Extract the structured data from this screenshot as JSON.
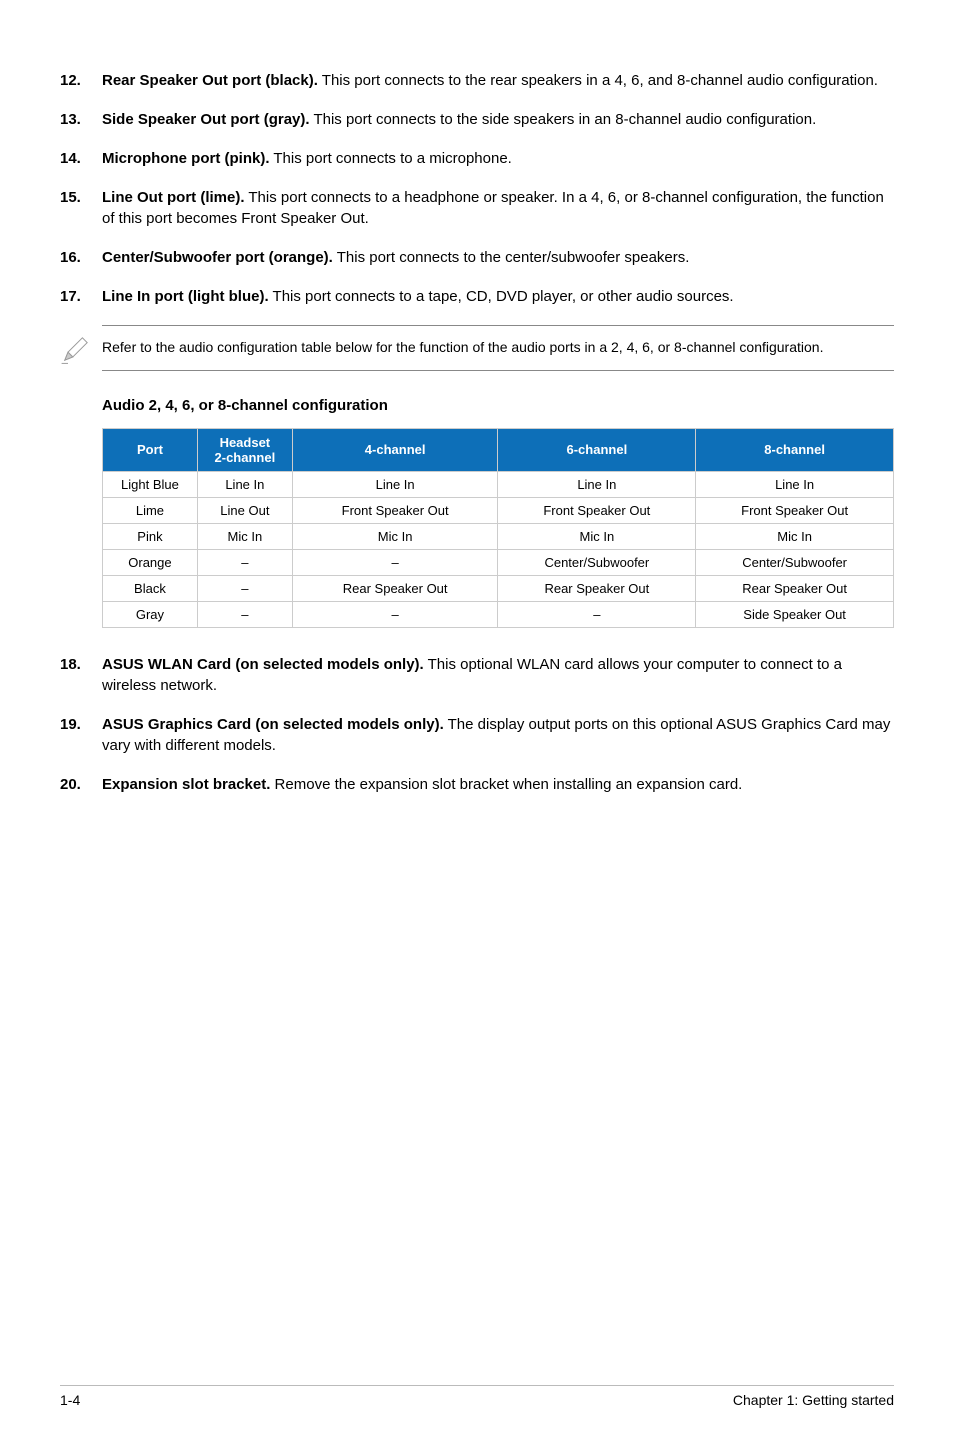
{
  "items": {
    "i12": {
      "num": "12.",
      "bold": "Rear Speaker Out port (black).",
      "text": " This port connects to the rear speakers in a 4, 6, and 8-channel audio configuration."
    },
    "i13": {
      "num": "13.",
      "bold": "Side Speaker Out port (gray).",
      "text": " This port connects to the side speakers in an 8-channel audio configuration."
    },
    "i14": {
      "num": "14.",
      "bold": "Microphone port (pink).",
      "text": " This port connects to a microphone."
    },
    "i15": {
      "num": "15.",
      "bold": "Line Out port (lime).",
      "text": " This port connects to a headphone or speaker. In a 4, 6, or 8-channel configuration, the function of this port becomes Front Speaker Out."
    },
    "i16": {
      "num": "16.",
      "bold": "Center/Subwoofer port (orange).",
      "text": " This port connects to the center/subwoofer speakers."
    },
    "i17": {
      "num": "17.",
      "bold": "Line In port (light blue).",
      "text": " This port connects to a tape, CD, DVD player, or other audio sources."
    },
    "i18": {
      "num": "18.",
      "bold": "ASUS WLAN Card (on selected models only).",
      "text": " This optional WLAN card allows your computer to connect to a wireless network."
    },
    "i19": {
      "num": "19.",
      "bold": "ASUS Graphics Card (on selected models only).",
      "text": " The display output ports on this optional ASUS Graphics Card may vary with different models."
    },
    "i20": {
      "num": "20.",
      "bold": "Expansion slot bracket.",
      "text": " Remove the expansion slot bracket when installing an expansion card."
    }
  },
  "note": "Refer to the audio configuration table below for the function of the audio ports in a 2, 4, 6, or 8-channel configuration.",
  "table": {
    "title": "Audio 2, 4, 6, or 8-channel configuration",
    "headers": {
      "port": "Port",
      "h2a": "Headset",
      "h2b": "2-channel",
      "h4": "4-channel",
      "h6": "6-channel",
      "h8": "8-channel"
    },
    "rows": [
      {
        "port": "Light Blue",
        "c2": "Line In",
        "c4": "Line In",
        "c6": "Line In",
        "c8": "Line In"
      },
      {
        "port": "Lime",
        "c2": "Line Out",
        "c4": "Front Speaker Out",
        "c6": "Front Speaker Out",
        "c8": "Front Speaker Out"
      },
      {
        "port": "Pink",
        "c2": "Mic In",
        "c4": "Mic In",
        "c6": "Mic In",
        "c8": "Mic In"
      },
      {
        "port": "Orange",
        "c2": "–",
        "c4": "–",
        "c6": "Center/Subwoofer",
        "c8": "Center/Subwoofer"
      },
      {
        "port": "Black",
        "c2": "–",
        "c4": "Rear Speaker Out",
        "c6": "Rear Speaker Out",
        "c8": "Rear Speaker Out"
      },
      {
        "port": "Gray",
        "c2": "–",
        "c4": "–",
        "c6": "–",
        "c8": "Side Speaker Out"
      }
    ]
  },
  "footer": {
    "left": "1-4",
    "right": "Chapter 1: Getting started"
  }
}
